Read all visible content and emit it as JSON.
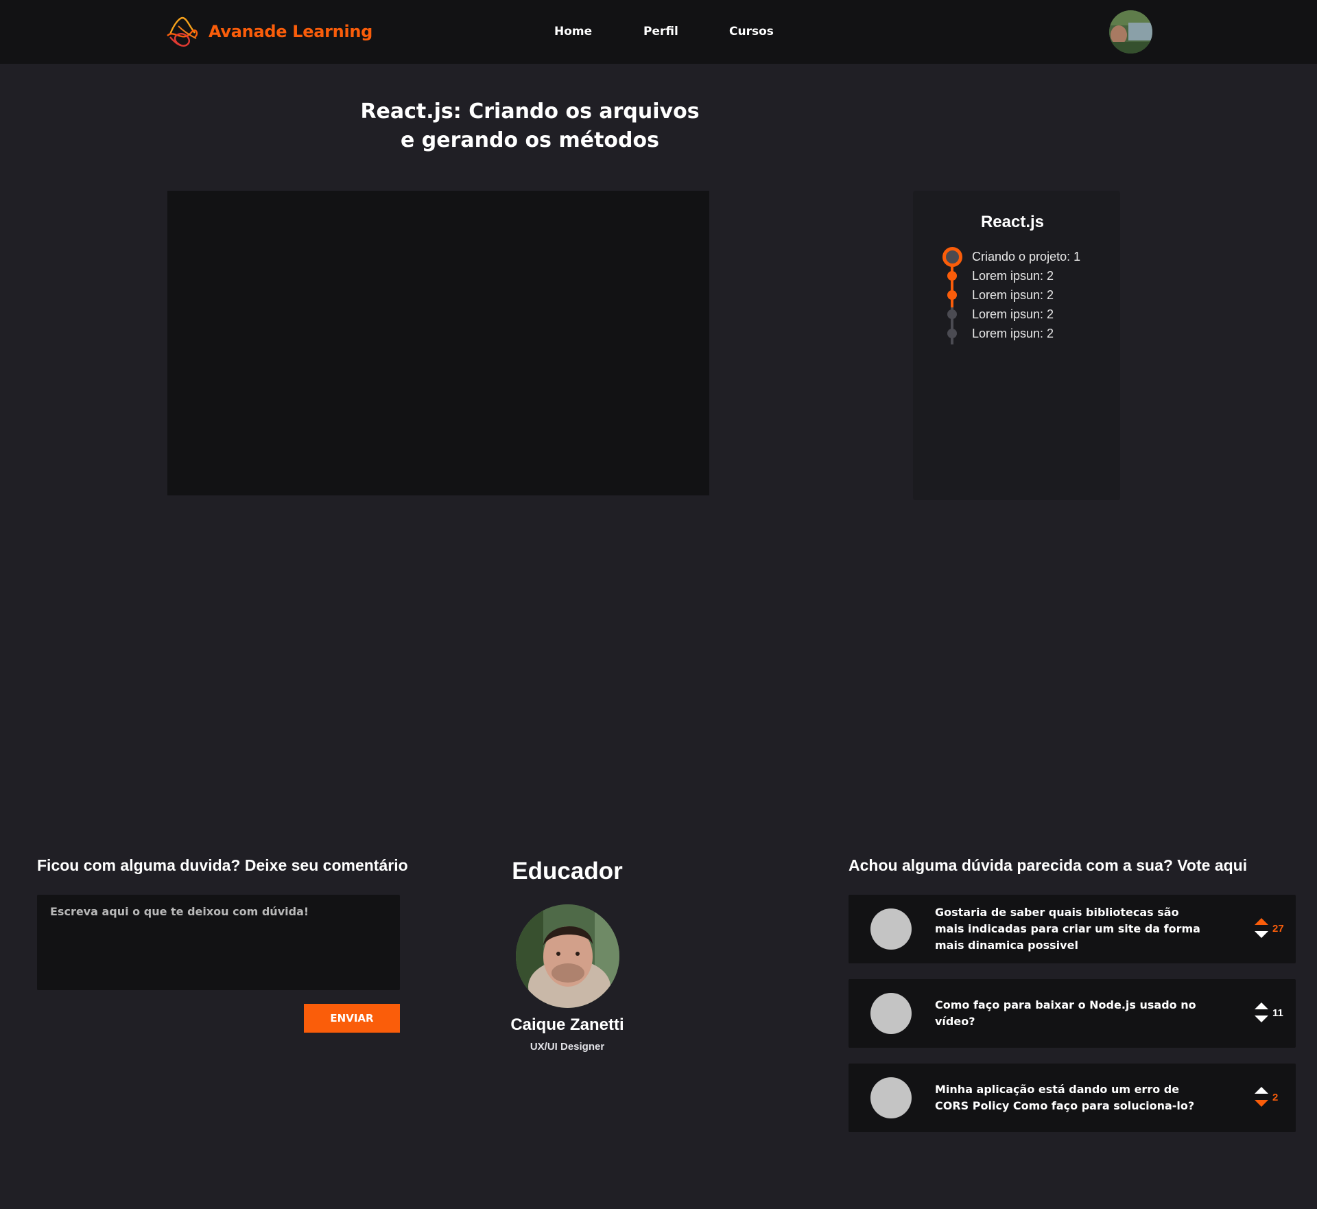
{
  "header": {
    "brand_name": "Avanade Learning",
    "nav": [
      {
        "label": "Home"
      },
      {
        "label": "Perfil"
      },
      {
        "label": "Cursos"
      }
    ]
  },
  "lesson": {
    "title_line1": "React.js: Criando os arquivos",
    "title_line2": "e gerando os métodos"
  },
  "course_sidebar": {
    "title": "React.js",
    "items": [
      {
        "label": "Criando o projeto: 1",
        "status": "current"
      },
      {
        "label": "Lorem ipsun: 2",
        "status": "done"
      },
      {
        "label": "Lorem ipsun: 2",
        "status": "done"
      },
      {
        "label": "Lorem ipsun: 2",
        "status": "pending"
      },
      {
        "label": "Lorem ipsun: 2",
        "status": "pending"
      }
    ]
  },
  "comment": {
    "title": "Ficou com alguma duvida? Deixe seu comentário",
    "placeholder": "Escreva aqui o que te deixou com dúvida!",
    "value": "",
    "send_label": "ENVIAR"
  },
  "educator": {
    "section_title": "Educador",
    "name": "Caique Zanetti",
    "role": "UX/UI Designer"
  },
  "votes": {
    "title": "Achou alguma dúvida parecida com a sua? Vote aqui",
    "questions": [
      {
        "text": "Gostaria de saber quais bibliotecas são mais indicadas para criar um site da forma mais dinamica possivel",
        "count": "27",
        "vote": "up"
      },
      {
        "text": "Como faço para baixar o Node.js usado no vídeo?",
        "count": "11",
        "vote": "none"
      },
      {
        "text": "Minha aplicação está dando um erro de CORS Policy Como faço para soluciona-lo?",
        "count": "2",
        "vote": "down"
      }
    ]
  },
  "colors": {
    "accent": "#fa5d0a",
    "background": "#201f25",
    "surface": "#121214"
  }
}
